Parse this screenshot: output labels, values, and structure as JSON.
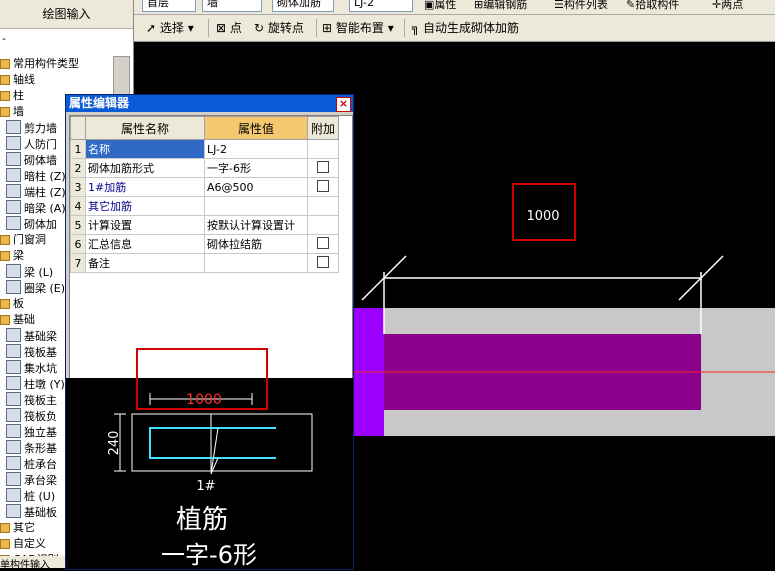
{
  "left_panel": {
    "title": "绘图输入",
    "pin": "-",
    "tree": [
      {
        "label": "常用构件类型",
        "kind": "folder"
      },
      {
        "label": "轴线",
        "kind": "folder"
      },
      {
        "label": "柱",
        "kind": "folder"
      },
      {
        "label": "墙",
        "kind": "folder"
      },
      {
        "label": "剪力墙",
        "kind": "comp"
      },
      {
        "label": "人防门",
        "kind": "comp"
      },
      {
        "label": "砌体墙",
        "kind": "comp"
      },
      {
        "label": "暗柱 (Z)",
        "kind": "comp"
      },
      {
        "label": "端柱 (Z)",
        "kind": "comp"
      },
      {
        "label": "暗梁 (A)",
        "kind": "comp"
      },
      {
        "label": "砌体加",
        "kind": "comp"
      },
      {
        "label": "门窗洞",
        "kind": "folder"
      },
      {
        "label": "梁",
        "kind": "folder"
      },
      {
        "label": "梁 (L)",
        "kind": "comp"
      },
      {
        "label": "圈梁 (E)",
        "kind": "comp"
      },
      {
        "label": "板",
        "kind": "folder"
      },
      {
        "label": "基础",
        "kind": "folder"
      },
      {
        "label": "基础梁",
        "kind": "comp"
      },
      {
        "label": "筏板基",
        "kind": "comp"
      },
      {
        "label": "集水坑",
        "kind": "comp"
      },
      {
        "label": "柱墩 (Y)",
        "kind": "comp"
      },
      {
        "label": "筏板主",
        "kind": "comp"
      },
      {
        "label": "筏板负",
        "kind": "comp"
      },
      {
        "label": "独立基",
        "kind": "comp"
      },
      {
        "label": "条形基",
        "kind": "comp"
      },
      {
        "label": "桩承台",
        "kind": "comp"
      },
      {
        "label": "承台梁",
        "kind": "comp"
      },
      {
        "label": "桩 (U)",
        "kind": "comp"
      },
      {
        "label": "基础板",
        "kind": "comp"
      },
      {
        "label": "其它",
        "kind": "folder"
      },
      {
        "label": "自定义",
        "kind": "folder"
      },
      {
        "label": "CAD识别",
        "kind": "folder"
      }
    ],
    "bottom": "单构件输入"
  },
  "toolbar_top": {
    "floor": "首层",
    "type": "墙",
    "subtype": "砌体加筋",
    "name": "LJ-2",
    "property": "属性",
    "edit_rebar": "编辑钢筋",
    "component_list": "构件列表",
    "pick": "拾取构件",
    "two_points": "两点"
  },
  "toolbar_second": {
    "select": "选择",
    "point": "点",
    "rotate_point": "旋转点",
    "smart_layout": "智能布置",
    "auto_generate": "自动生成砌体加筋"
  },
  "dialog": {
    "title": "属性编辑器",
    "close": "×",
    "headers": {
      "name": "属性名称",
      "value": "属性值",
      "extra": "附加"
    },
    "rows": [
      {
        "num": "1",
        "name": "名称",
        "value": "LJ-2",
        "checkbox": false
      },
      {
        "num": "2",
        "name": "砌体加筋形式",
        "value": "一字-6形",
        "checkbox": true
      },
      {
        "num": "3",
        "name": "1#加筋",
        "value": "A6@500",
        "checkbox": true
      },
      {
        "num": "4",
        "name": "其它加筋",
        "value": "",
        "checkbox": false
      },
      {
        "num": "5",
        "name": "计算设置",
        "value": "按默认计算设置计",
        "checkbox": false
      },
      {
        "num": "6",
        "name": "汇总信息",
        "value": "砌体拉结筋",
        "checkbox": true
      },
      {
        "num": "7",
        "name": "备注",
        "value": "",
        "checkbox": true
      }
    ]
  },
  "preview": {
    "length_label": "1000",
    "width_label": "240",
    "rebar_label": "1#",
    "caption1": "植筋",
    "caption2": "一字-6形"
  },
  "canvas": {
    "dimension_label": "1000"
  },
  "colors": {
    "wall_gray": "#c8c8c8",
    "rebar_purple": "#8b008b",
    "end_violet": "#9b00ff",
    "annotation_red": "#d00000",
    "preview_rebar": "#40e0ff"
  }
}
